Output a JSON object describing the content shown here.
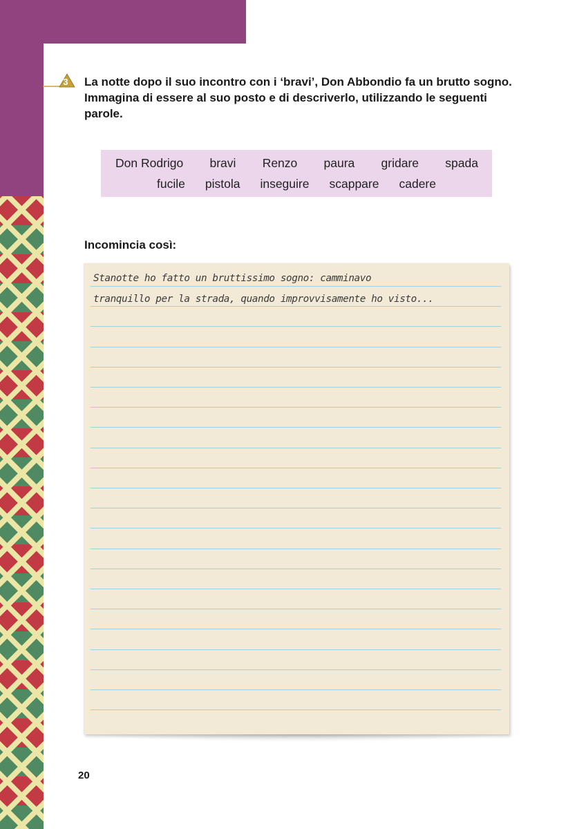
{
  "exercise": {
    "number": "3",
    "instruction": "La notte dopo il suo incontro con i ‘bravi’, Don Abbondio fa un brutto sogno. Immagina di essere al suo posto e di descriverlo, utilizzando le seguenti parole."
  },
  "word_box": {
    "row1": [
      "Don Rodrigo",
      "bravi",
      "Renzo",
      "paura",
      "gridare",
      "spada"
    ],
    "row2": [
      "fucile",
      "pistola",
      "inseguire",
      "scappare",
      "cadere"
    ]
  },
  "start_label": "Incomincia così:",
  "notepad": {
    "lines": [
      "Stanotte ho fatto un bruttissimo sogno: camminavo",
      "tranquillo per la strada, quando improvvisamente ho visto..."
    ],
    "empty_line_count": 20
  },
  "page_number": "20",
  "colors": {
    "purple": "#91437f",
    "word_box_bg": "#ecd6ec",
    "notepad_bg": "#f2ead6",
    "ruled_line": "#9dd3e0",
    "marker_gold": "#c4a23a"
  }
}
